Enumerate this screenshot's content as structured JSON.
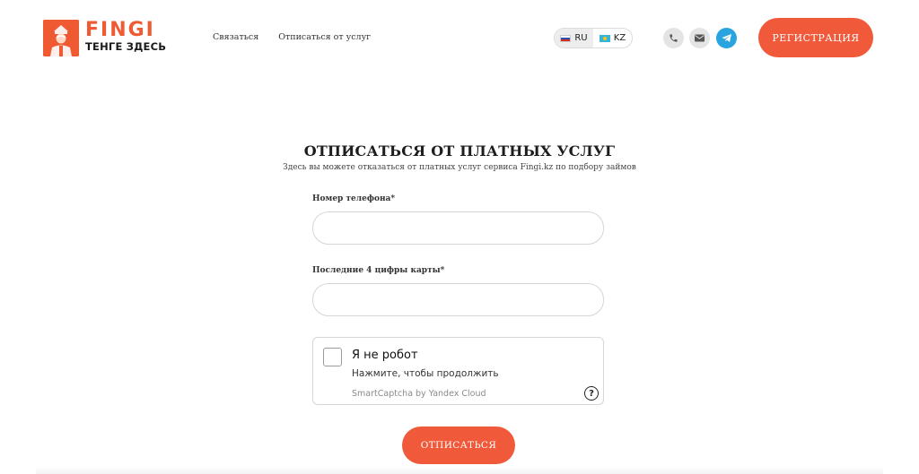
{
  "header": {
    "logo": {
      "brand": "FINGI",
      "tagline": "ТЕНГЕ ЗДЕСЬ",
      "brand_color": "#f05a32"
    },
    "nav": [
      {
        "label": "Связаться"
      },
      {
        "label": "Отписаться от услуг"
      }
    ],
    "languages": [
      {
        "code": "RU",
        "flag": "flag-ru",
        "active": true
      },
      {
        "code": "KZ",
        "flag": "flag-kz",
        "active": false
      }
    ],
    "contact_icons": [
      "phone-icon",
      "mail-icon",
      "telegram-icon"
    ],
    "register_label": "РЕГИСТРАЦИЯ",
    "accent_color": "#f05a3a"
  },
  "main": {
    "title": "ОТПИСАТЬСЯ ОТ ПЛАТНЫХ УСЛУГ",
    "subtitle": "Здесь вы можете отказаться от платных услуг сервиса Fingi.kz по подбору займов",
    "phone_field": {
      "label": "Номер телефона*",
      "value": "",
      "placeholder": ""
    },
    "card_field": {
      "label": "Последние 4 цифры карты*",
      "value": "",
      "placeholder": ""
    },
    "captcha": {
      "title": "Я не робот",
      "subtitle": "Нажмите, чтобы продолжить",
      "brand": "SmartCaptcha by Yandex Cloud",
      "help": "?",
      "checked": false
    },
    "submit_label": "ОТПИСАТЬСЯ"
  }
}
